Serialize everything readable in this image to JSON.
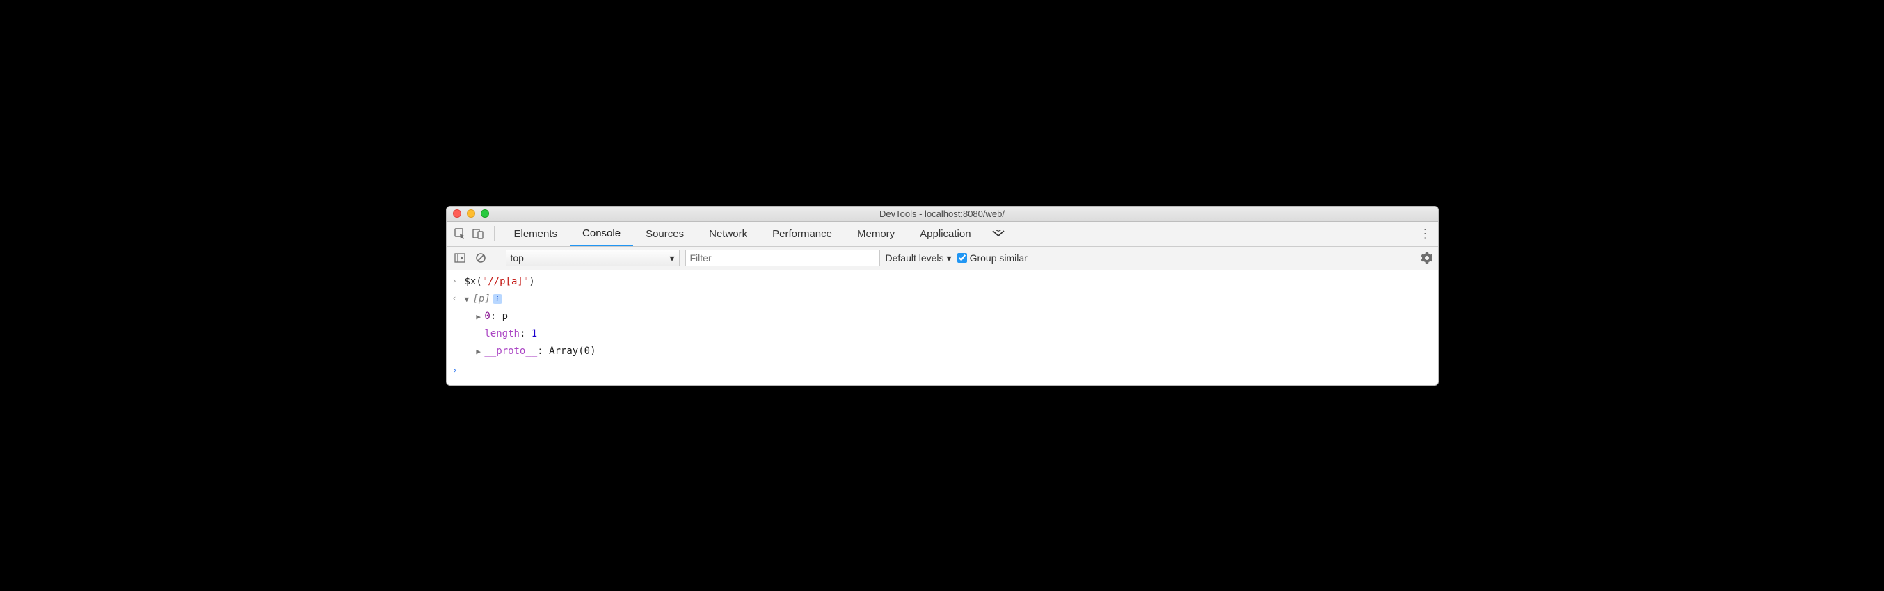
{
  "window": {
    "title": "DevTools - localhost:8080/web/"
  },
  "tabs": {
    "items": [
      "Elements",
      "Console",
      "Sources",
      "Network",
      "Performance",
      "Memory",
      "Application"
    ],
    "active_index": 1
  },
  "toolbar": {
    "context": "top",
    "filter_placeholder": "Filter",
    "levels_label": "Default levels",
    "group_similar_label": "Group similar",
    "group_similar_checked": true
  },
  "console": {
    "input_line": {
      "fn": "$x",
      "arg": "\"//p[a]\""
    },
    "output": {
      "summary": "[p]",
      "entries": [
        {
          "key": "0",
          "value": "p",
          "kind": "element",
          "expandable": true
        },
        {
          "key": "length",
          "value": "1",
          "kind": "number",
          "expandable": false
        },
        {
          "key": "__proto__",
          "value": "Array(0)",
          "kind": "array",
          "expandable": true
        }
      ]
    }
  }
}
